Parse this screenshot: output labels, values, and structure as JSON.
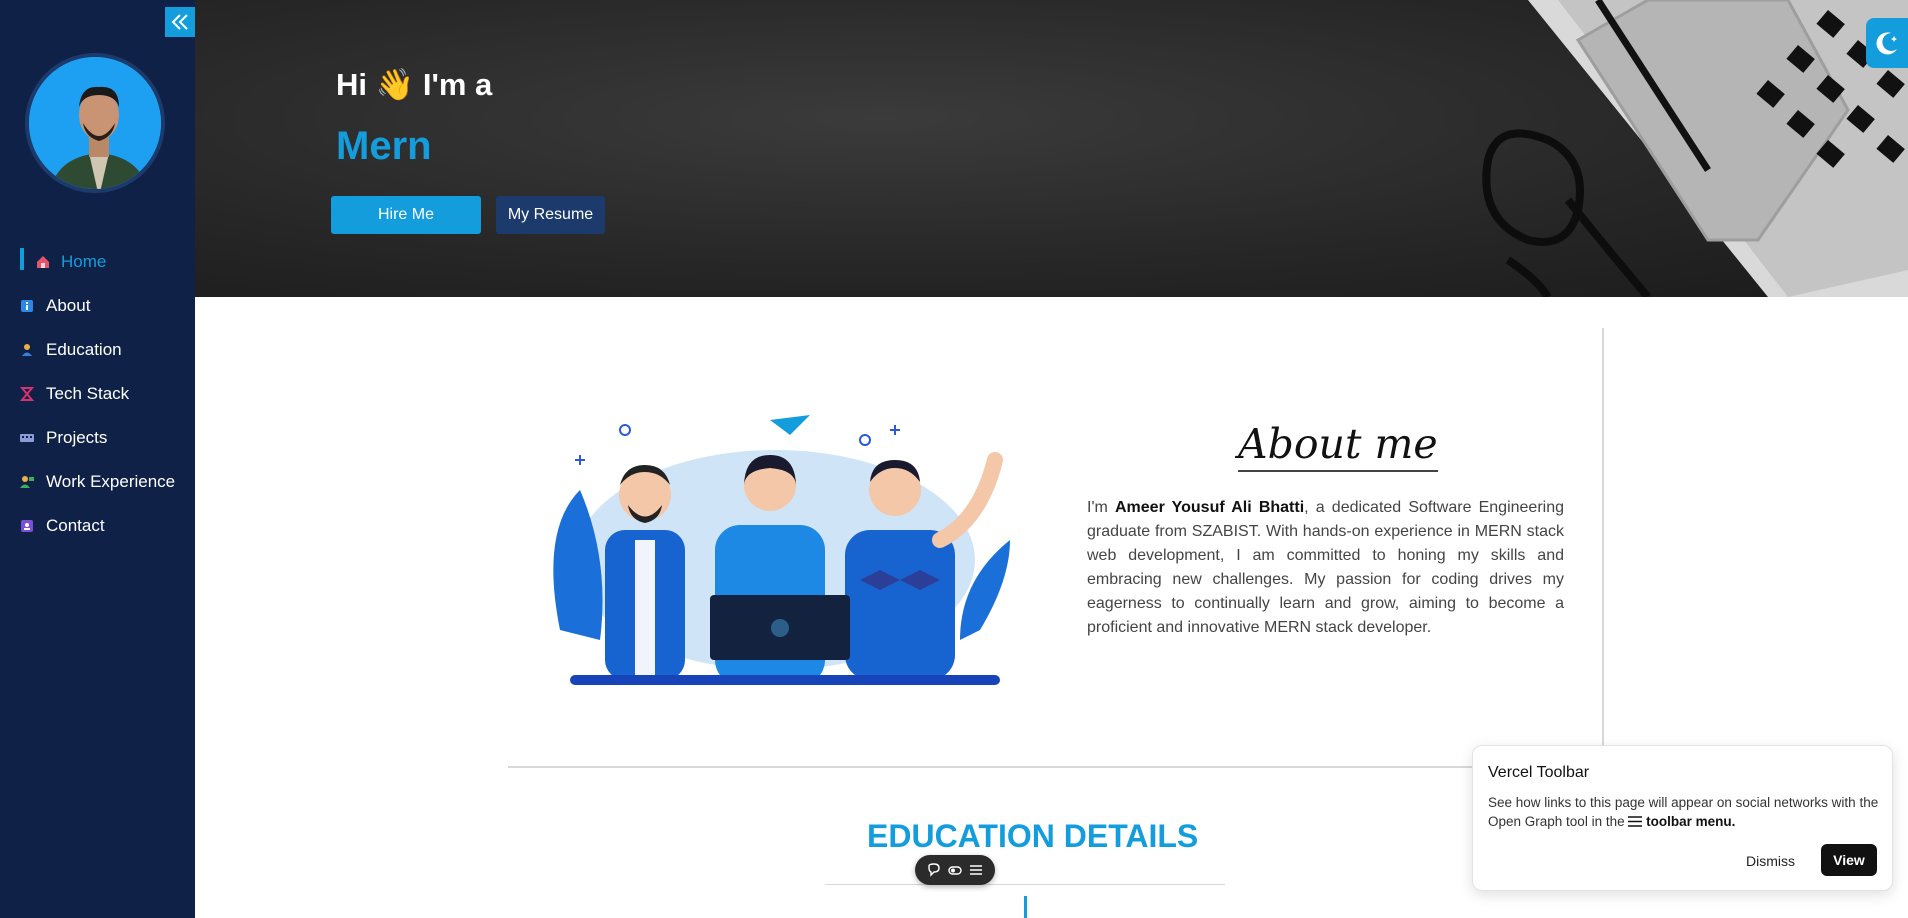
{
  "sidebar": {
    "collapse_icon": "double-chevron-left-icon",
    "items": [
      {
        "label": "Home",
        "icon": "home-icon",
        "color": "#e5546a",
        "active": true
      },
      {
        "label": "About",
        "icon": "info-icon",
        "color": "#2b88e6"
      },
      {
        "label": "Education",
        "icon": "student-icon",
        "color": "#e8b04a"
      },
      {
        "label": "Tech Stack",
        "icon": "hourglass-icon",
        "color": "#d6336c"
      },
      {
        "label": "Projects",
        "icon": "keyboard-icon",
        "color": "#8e9bd6"
      },
      {
        "label": "Work Experience",
        "icon": "teacher-icon",
        "color": "#3fae5a"
      },
      {
        "label": "Contact",
        "icon": "contact-card-icon",
        "color": "#7b4fd6"
      }
    ]
  },
  "hero": {
    "greeting_hi": "Hi",
    "greeting_wave": "👋",
    "greeting_rest": "I'm a",
    "role": "Mern",
    "hire_label": "Hire Me",
    "resume_label": "My Resume"
  },
  "about": {
    "title": "About me",
    "text_prefix": "I'm ",
    "name": "Ameer Yousuf Ali Bhatti",
    "text_suffix": ", a dedicated Software Engineering graduate from SZABIST. With hands-on experience in MERN stack web development, I am committed to honing my skills and embracing new challenges. My passion for coding drives my eagerness to continually learn and grow, aiming to become a proficient and innovative MERN stack developer."
  },
  "education": {
    "title": "EDUCATION DETAILS"
  },
  "vercel_popup": {
    "title": "Vercel Toolbar",
    "body_prefix": "See how links to this page will appear on social networks with the Open Graph tool in the ",
    "body_bold": "toolbar menu.",
    "dismiss_label": "Dismiss",
    "view_label": "View"
  },
  "colors": {
    "accent": "#149ddd",
    "sidebar_bg": "#0f2147",
    "resume_btn": "#1c3a6b"
  }
}
